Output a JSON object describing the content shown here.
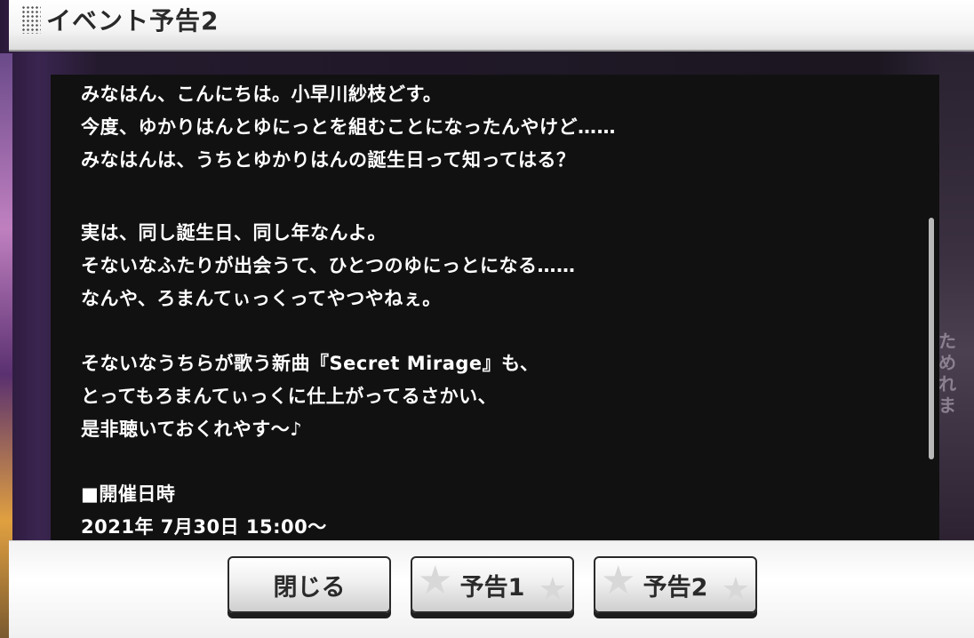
{
  "title": "イベント予告2",
  "message": {
    "paragraphs": [
      [
        "みなはん、こんにちは。小早川紗枝どす。",
        "今度、ゆかりはんとゆにっとを組むことになったんやけど……",
        "みなはんは、うちとゆかりはんの誕生日って知ってはる？"
      ],
      [
        "実は、同し誕生日、同し年なんよ。",
        "そないなふたりが出会うて、ひとつのゆにっとになる……",
        "なんや、ろまんてぃっくってやつやねぇ。"
      ],
      [
        "そないなうちらが歌う新曲『Secret Mirage』も、",
        "とってもろまんてぃっくに仕上がってるさかい、",
        "是非聴いておくれやす～♪"
      ],
      [
        "■開催日時",
        "2021年 7月30日 15:00～"
      ]
    ]
  },
  "background": {
    "right_text": "ため\nれま"
  },
  "buttons": {
    "close": "閉じる",
    "preview1": "予告1",
    "preview2": "予告2"
  }
}
